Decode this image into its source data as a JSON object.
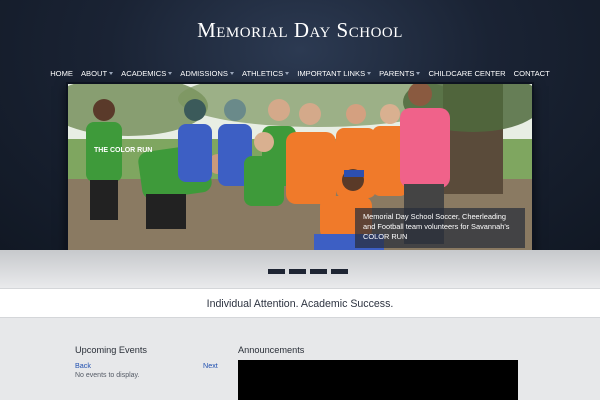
{
  "site": {
    "title": "Memorial Day School"
  },
  "nav": [
    {
      "label": "HOME",
      "dropdown": false
    },
    {
      "label": "ABOUT",
      "dropdown": true
    },
    {
      "label": "ACADEMICS",
      "dropdown": true
    },
    {
      "label": "ADMISSIONS",
      "dropdown": true
    },
    {
      "label": "ATHLETICS",
      "dropdown": true
    },
    {
      "label": "IMPORTANT LINKS",
      "dropdown": true
    },
    {
      "label": "PARENTS",
      "dropdown": true
    },
    {
      "label": "CHILDCARE CENTER",
      "dropdown": false
    },
    {
      "label": "CONTACT",
      "dropdown": false
    }
  ],
  "slider": {
    "caption": "Memorial Day School Soccer, Cheerleading and Football team volunteers for Savannah's COLOR RUN",
    "shirt_text": "THE COLOR RUN",
    "dots": 4,
    "active_dot": 0
  },
  "tagline": "Individual Attention. Academic Success.",
  "events": {
    "title": "Upcoming Events",
    "back": "Back",
    "next": "Next",
    "empty": "No events to display."
  },
  "announcements": {
    "title": "Announcements"
  },
  "colors": {
    "header_bg": "#1a2334",
    "nav_text": "#ffffff",
    "link": "#1f4fb0",
    "shirt_green": "#3e9a3a",
    "shirt_orange": "#f07a2a",
    "shirt_pink": "#f0628a",
    "shirt_blue": "#3d5fc4"
  }
}
